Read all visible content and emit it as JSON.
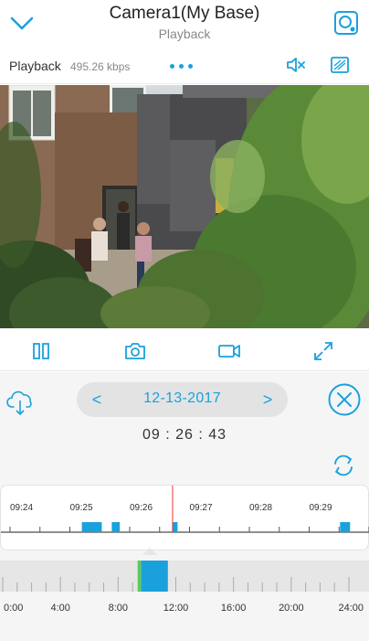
{
  "header": {
    "title": "Camera1(My Base)",
    "subtitle": "Playback",
    "back_icon": "chevron-down-icon",
    "camera_icon": "camera-settings-icon"
  },
  "status": {
    "label": "Playback",
    "bitrate": "495.26 kbps",
    "page_dots": 3,
    "mute_icon": "speaker-mute-icon",
    "quality_icon": "hd-quality-icon"
  },
  "controls": {
    "icons": [
      "split-view-icon",
      "snapshot-icon",
      "record-icon",
      "fullscreen-icon"
    ]
  },
  "playback": {
    "download_icon": "cloud-download-icon",
    "date": "12-13-2017",
    "prev_label": "<",
    "next_label": ">",
    "close_icon": "close-icon",
    "time": "09 : 26 : 43",
    "refresh_icon": "refresh-icon"
  },
  "detail_timeline": {
    "labels": [
      "09:24",
      "09:25",
      "09:26",
      "09:27",
      "09:28",
      "09:29"
    ],
    "range_minutes": [
      9.35,
      9.5
    ],
    "playhead": "09:26:43",
    "events": [
      {
        "start": "09:25:12",
        "end": "09:25:22"
      },
      {
        "start": "09:25:22",
        "end": "09:25:32"
      },
      {
        "start": "09:25:42",
        "end": "09:25:50"
      },
      {
        "start": "09:26:43",
        "end": "09:26:48"
      },
      {
        "start": "09:29:31",
        "end": "09:29:41"
      }
    ]
  },
  "overview_timeline": {
    "labels": [
      "0:00",
      "4:00",
      "8:00",
      "12:00",
      "16:00",
      "20:00",
      "24:00"
    ],
    "segments": [
      {
        "start": 9.35,
        "end": 9.6,
        "color": "#5cc85c"
      },
      {
        "start": 9.6,
        "end": 11.45,
        "color": "#1aa1dc"
      }
    ]
  },
  "colors": {
    "accent": "#1aa1dc",
    "event": "#1aa1dc",
    "playhead": "#e53935",
    "motion": "#5cc85c"
  }
}
